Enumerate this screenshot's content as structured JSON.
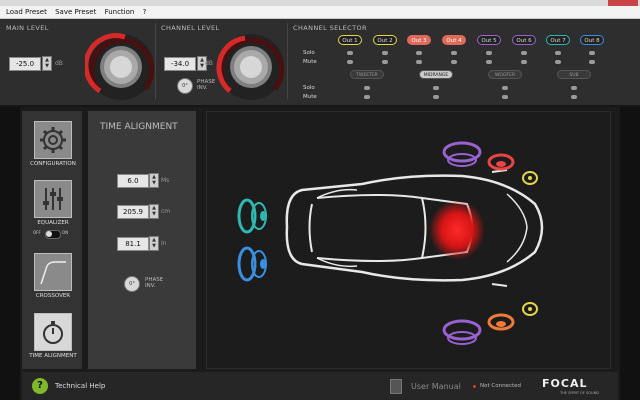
{
  "menu": {
    "items": [
      "Load Preset",
      "Save Preset",
      "Function",
      "?"
    ]
  },
  "main_level": {
    "title": "MAIN LEVEL",
    "value": "-25.0",
    "unit": "dB"
  },
  "channel_level": {
    "title": "CHANNEL LEVEL",
    "value": "-34.0",
    "unit": "dB",
    "phase_label": "PHASE INV.",
    "phase_button": "0°"
  },
  "channel_selector": {
    "title": "CHANNEL SELECTOR",
    "outputs": [
      {
        "label": "Out 1",
        "color": "#e6d64a",
        "selected": false
      },
      {
        "label": "Out 2",
        "color": "#e6d64a",
        "selected": false
      },
      {
        "label": "Out 3",
        "color": "#e06a5a",
        "selected": true
      },
      {
        "label": "Out 4",
        "color": "#e06a5a",
        "selected": true
      },
      {
        "label": "Out 5",
        "color": "#9a62d0",
        "selected": false
      },
      {
        "label": "Out 6",
        "color": "#9a62d0",
        "selected": false
      },
      {
        "label": "Out 7",
        "color": "#2fb8b3",
        "selected": false
      },
      {
        "label": "Out 8",
        "color": "#3b8fe0",
        "selected": false
      }
    ],
    "solo": "Solo",
    "mute": "Mute",
    "bands": [
      {
        "label": "TWEETER",
        "active": false
      },
      {
        "label": "MIDRANGE",
        "active": true
      },
      {
        "label": "WOOFER",
        "active": false
      },
      {
        "label": "SUB",
        "active": false
      }
    ]
  },
  "nav": {
    "items": [
      {
        "label": "CONFIGURATION",
        "icon": "gear-icon",
        "active": false
      },
      {
        "label": "EQUALIZER",
        "icon": "sliders-icon",
        "active": false
      },
      {
        "label": "CROSSOVER",
        "icon": "crossover-curve-icon",
        "active": false
      },
      {
        "label": "TIME ALIGNMENT",
        "icon": "stopwatch-icon",
        "active": true
      }
    ],
    "eq_toggle": {
      "off": "OFF",
      "on": "ON"
    }
  },
  "time_alignment": {
    "title": "TIME ALIGNMENT",
    "ms": {
      "value": "6.0",
      "unit": "Ms"
    },
    "cm": {
      "value": "205.9",
      "unit": "cm"
    },
    "in": {
      "value": "81.1",
      "unit": "In"
    },
    "phase_label": "PHASE INV.",
    "phase_button": "0°"
  },
  "footer": {
    "help": "Technical Help",
    "manual": "User Manual",
    "status": "Not Connected",
    "status_color": "#d63a3a",
    "brand": "FOCAL",
    "tagline": "THE SPIRIT OF SOUND"
  }
}
